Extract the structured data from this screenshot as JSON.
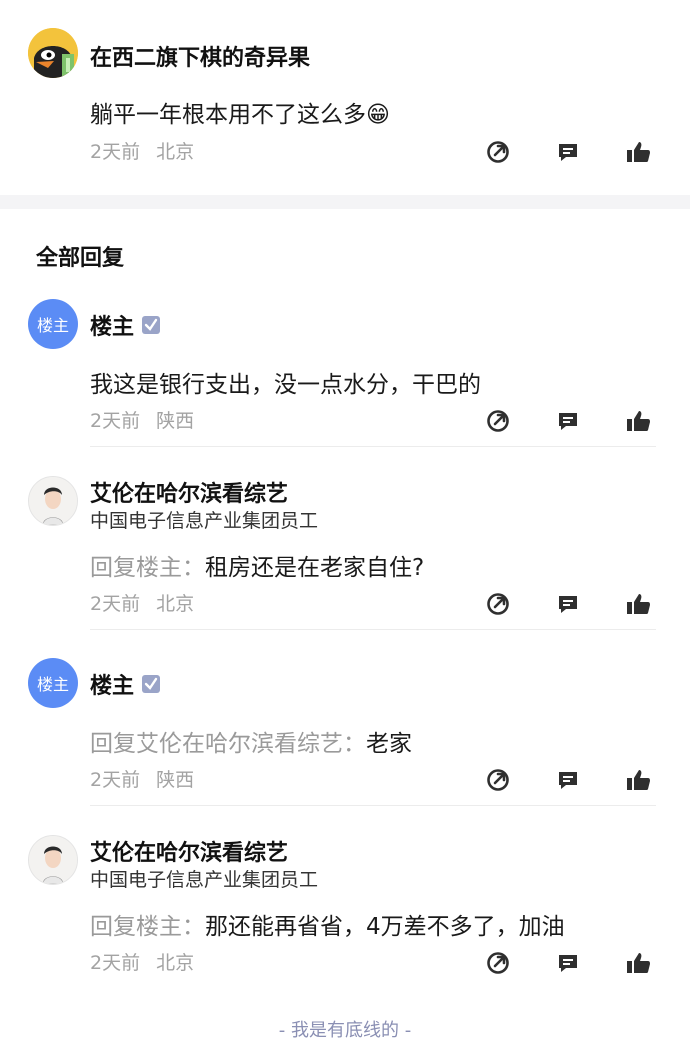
{
  "top_comment": {
    "username": "在西二旗下棋的奇异果",
    "content": "躺平一年根本用不了这么多",
    "emoji": "😁",
    "time": "2天前",
    "location": "北京"
  },
  "section_title": "全部回复",
  "replies": [
    {
      "username": "楼主",
      "avatar_text": "楼主",
      "reply_prefix": "",
      "reply_to": "",
      "content": "我这是银行支出，没一点水分，干巴的",
      "time": "2天前",
      "location": "陕西"
    },
    {
      "username": "艾伦在哈尔滨看综艺",
      "subtitle": "中国电子信息产业集团员工",
      "reply_prefix": "回复",
      "reply_to": "楼主：",
      "content": "租房还是在老家自住?",
      "time": "2天前",
      "location": "北京"
    },
    {
      "username": "楼主",
      "avatar_text": "楼主",
      "reply_prefix": "回复",
      "reply_to": "艾伦在哈尔滨看综艺：",
      "content": "老家",
      "time": "2天前",
      "location": "陕西"
    },
    {
      "username": "艾伦在哈尔滨看综艺",
      "subtitle": "中国电子信息产业集团员工",
      "reply_prefix": "回复",
      "reply_to": "楼主：",
      "content": "那还能再省省，4万差不多了，加油",
      "time": "2天前",
      "location": "北京"
    }
  ],
  "footer": "- 我是有底线的 -",
  "icons": [
    "share-icon",
    "comment-icon",
    "like-icon"
  ],
  "colors": {
    "icon": "#2f2f2f",
    "meta": "#a3a3a3",
    "avatar_lz": "#5b8cf5",
    "badge": "#9aa4c8"
  }
}
